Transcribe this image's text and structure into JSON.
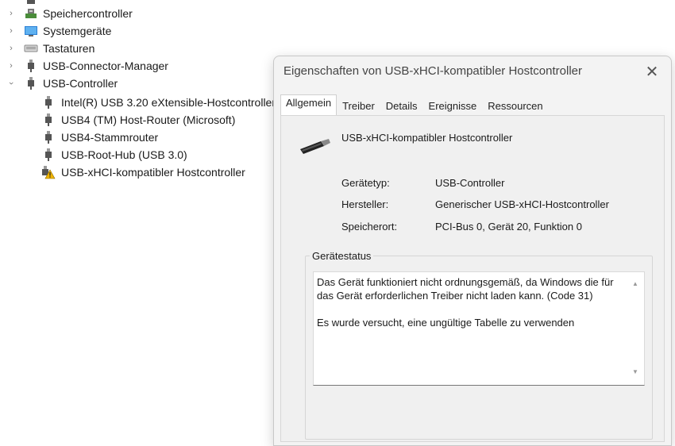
{
  "tree": {
    "items": [
      {
        "label": "Speichercontroller",
        "expanded": false,
        "icon": "storage-controller-icon"
      },
      {
        "label": "Systemgeräte",
        "expanded": false,
        "icon": "system-devices-icon"
      },
      {
        "label": "Tastaturen",
        "expanded": false,
        "icon": "keyboard-icon"
      },
      {
        "label": "USB-Connector-Manager",
        "expanded": false,
        "icon": "usb-plug-icon"
      },
      {
        "label": "USB-Controller",
        "expanded": true,
        "icon": "usb-plug-icon"
      }
    ],
    "children": [
      {
        "label": "Intel(R) USB 3.20 eXtensible-Hostcontroller",
        "icon": "usb-plug-icon"
      },
      {
        "label": "USB4 (TM) Host-Router (Microsoft)",
        "icon": "usb-plug-icon"
      },
      {
        "label": "USB4-Stammrouter",
        "icon": "usb-plug-icon"
      },
      {
        "label": "USB-Root-Hub (USB 3.0)",
        "icon": "usb-plug-icon"
      },
      {
        "label": "USB-xHCI-kompatibler Hostcontroller",
        "icon": "usb-warning-icon"
      }
    ]
  },
  "dialog": {
    "title": "Eigenschaften von USB-xHCI-kompatibler Hostcontroller",
    "close_icon": "close-icon",
    "tabs": [
      "Allgemein",
      "Treiber",
      "Details",
      "Ereignisse",
      "Ressourcen"
    ],
    "active_tab": "Allgemein",
    "device_name": "USB-xHCI-kompatibler Hostcontroller",
    "properties": [
      {
        "label": "Gerätetyp:",
        "value": "USB-Controller"
      },
      {
        "label": "Hersteller:",
        "value": "Generischer USB-xHCI-Hostcontroller"
      },
      {
        "label": "Speicherort:",
        "value": "PCI-Bus 0, Gerät 20, Funktion 0"
      }
    ],
    "status_legend": "Gerätestatus",
    "status_text": "Das Gerät funktioniert nicht ordnungsgemäß, da Windows die für das Gerät erforderlichen Treiber nicht laden kann. (Code 31)\n\nEs wurde versucht, eine ungültige Tabelle zu verwenden"
  },
  "colors": {
    "warning": "#f0b400",
    "accent": "#0067c0"
  }
}
